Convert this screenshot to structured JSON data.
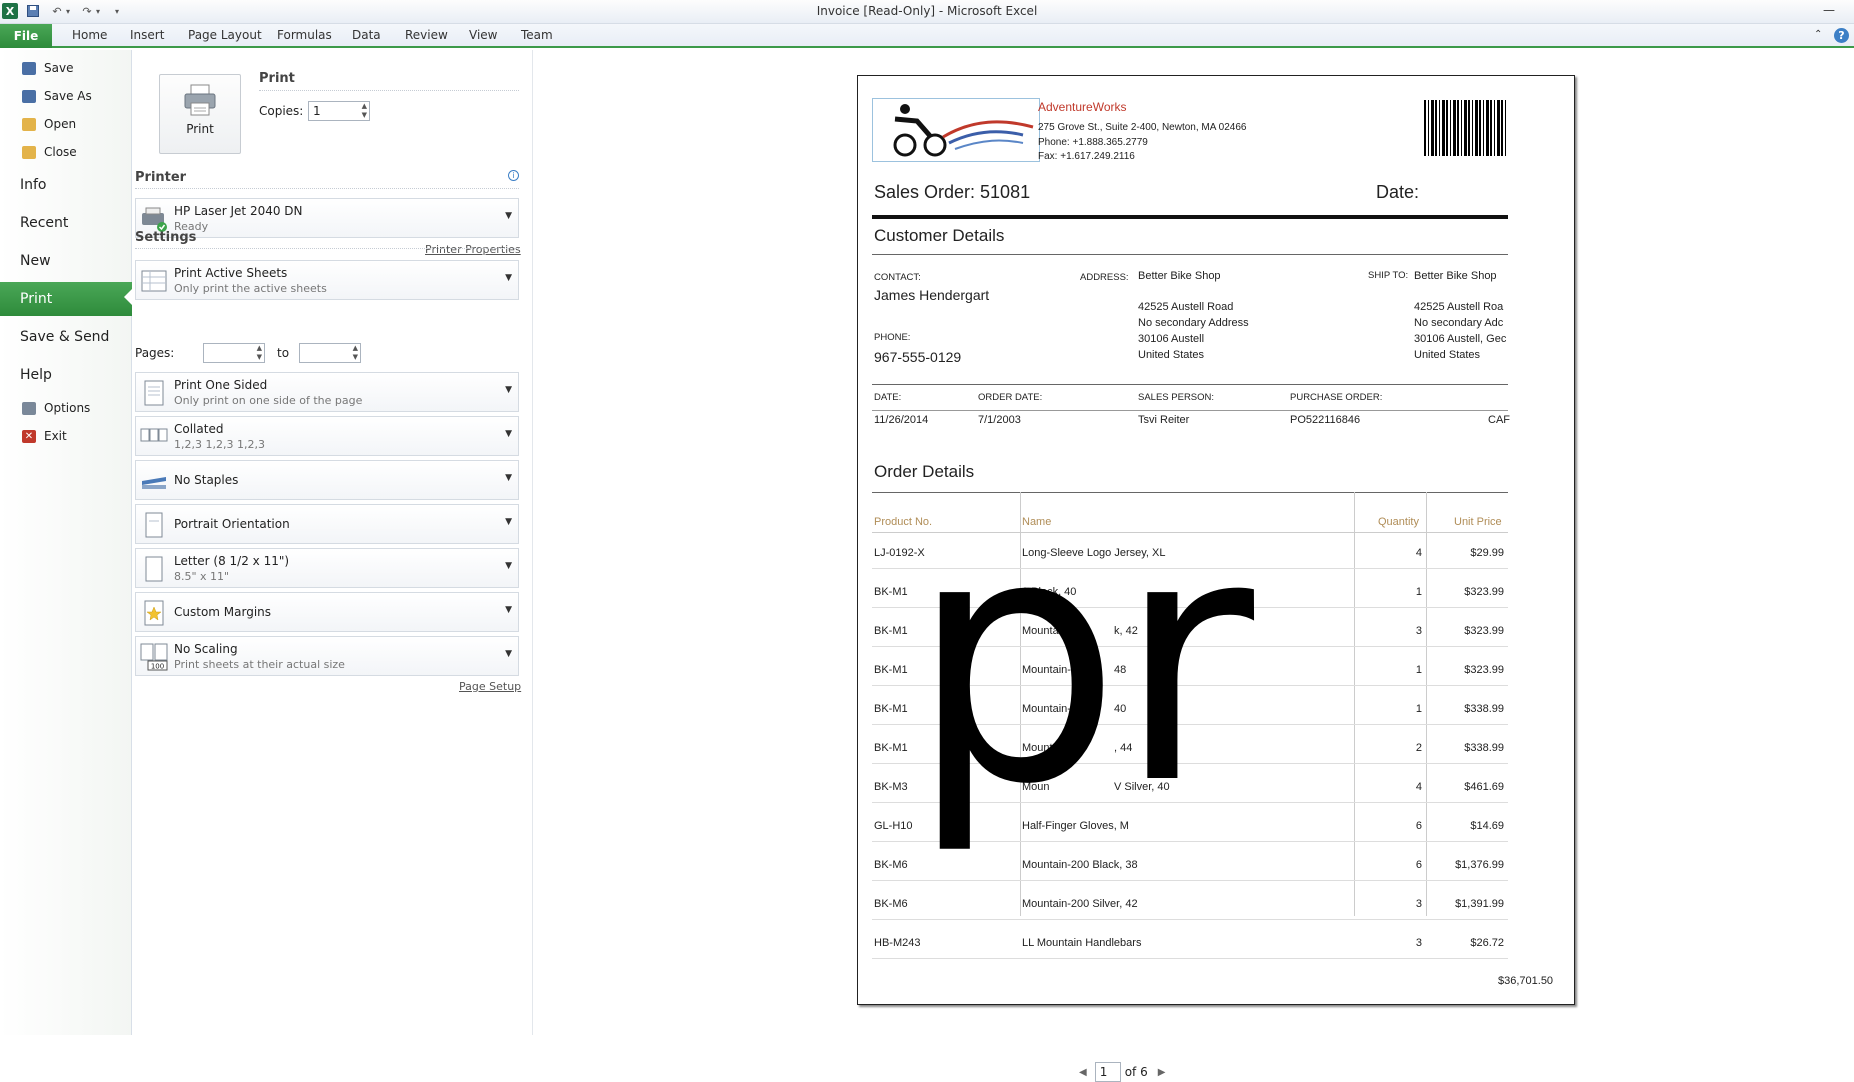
{
  "window": {
    "title": "Invoice  [Read-Only]  -  Microsoft Excel",
    "app_icon": "excel-icon"
  },
  "ribbon": {
    "file": "File",
    "tabs": [
      "Home",
      "Insert",
      "Page Layout",
      "Formulas",
      "Data",
      "Review",
      "View",
      "Team"
    ]
  },
  "nav": {
    "save": "Save",
    "save_as": "Save As",
    "open": "Open",
    "close": "Close",
    "info": "Info",
    "recent": "Recent",
    "new": "New",
    "print": "Print",
    "save_send": "Save & Send",
    "help": "Help",
    "options": "Options",
    "exit": "Exit"
  },
  "print": {
    "heading": "Print",
    "button": "Print",
    "copies_label": "Copies:",
    "copies_value": "1"
  },
  "printer": {
    "heading": "Printer",
    "name": "HP Laser Jet 2040 DN",
    "status": "Ready",
    "properties_link": "Printer Properties"
  },
  "settings": {
    "heading": "Settings",
    "sheets": {
      "title": "Print Active Sheets",
      "sub": "Only print the active sheets"
    },
    "pages_label": "Pages:",
    "to_label": "to",
    "sided": {
      "title": "Print One Sided",
      "sub": "Only print on one side of the page"
    },
    "collated": {
      "title": "Collated",
      "sub": "1,2,3    1,2,3    1,2,3"
    },
    "staples": {
      "title": "No Staples"
    },
    "orientation": {
      "title": "Portrait Orientation"
    },
    "paper": {
      "title": "Letter (8 1/2 x 11\")",
      "sub": "8.5\" x 11\""
    },
    "margins": {
      "title": "Custom Margins"
    },
    "scaling": {
      "title": "No Scaling",
      "sub": "Print sheets at their actual size"
    },
    "scaling_badge": "100",
    "page_setup_link": "Page Setup"
  },
  "invoice": {
    "company": "AdventureWorks",
    "address": "275 Grove St., Suite 2-400, Newton, MA 02466",
    "phone": "Phone: +1.888.365.2779",
    "fax": "Fax: +1.617.249.2116",
    "sales_order": "Sales Order: 51081",
    "date_label": "Date:",
    "customer_details": "Customer Details",
    "contact_label": "CONTACT:",
    "contact_name": "James Hendergart",
    "phone_label": "PHONE:",
    "phone_value": "967-555-0129",
    "address_label": "ADDRESS:",
    "address_lines": [
      "Better Bike Shop",
      "",
      "42525 Austell Road",
      "No secondary Address",
      "30106 Austell",
      "United States"
    ],
    "ship_to_label": "SHIP TO:",
    "ship_lines": [
      "Better Bike Shop",
      "",
      "42525 Austell Roa",
      "No secondary Adc",
      "30106 Austell, Gec",
      "United States"
    ],
    "info_headers": [
      "DATE:",
      "ORDER DATE:",
      "SALES PERSON:",
      "PURCHASE ORDER:"
    ],
    "info_values": [
      "11/26/2014",
      "7/1/2003",
      "Tsvi Reiter",
      "PO522116846",
      "CAF"
    ],
    "order_details": "Order Details",
    "columns": [
      "Product No.",
      "Name",
      "Quantity",
      "Unit Price"
    ],
    "rows": [
      {
        "no": "LJ-0192-X",
        "name": "Long-Sleeve Logo Jersey, XL",
        "qty": "4",
        "price": "$29.99"
      },
      {
        "no": "BK-M1",
        "name": "0 Black, 40",
        "qty": "1",
        "price": "$323.99"
      },
      {
        "no": "BK-M1",
        "name": "Mountain-",
        "name2": "k, 42",
        "qty": "3",
        "price": "$323.99"
      },
      {
        "no": "BK-M1",
        "name": "Mountain-500",
        "name2": "48",
        "qty": "1",
        "price": "$323.99"
      },
      {
        "no": "BK-M1",
        "name": "Mountain-500",
        "name2": "40",
        "qty": "1",
        "price": "$338.99"
      },
      {
        "no": "BK-M1",
        "name": "Mountain-5",
        "name2": ", 44",
        "qty": "2",
        "price": "$338.99"
      },
      {
        "no": "BK-M3",
        "name": "Moun",
        "name2": "V Silver, 40",
        "qty": "4",
        "price": "$461.69"
      },
      {
        "no": "GL-H10",
        "name": "Half-Finger Gloves, M",
        "qty": "6",
        "price": "$14.69"
      },
      {
        "no": "BK-M6",
        "name": "Mountain-200 Black, 38",
        "qty": "6",
        "price": "$1,376.99"
      },
      {
        "no": "BK-M6",
        "name": "Mountain-200 Silver, 42",
        "qty": "3",
        "price": "$1,391.99"
      },
      {
        "no": "HB-M243",
        "name": "LL Mountain Handlebars",
        "qty": "3",
        "price": "$26.72"
      }
    ],
    "total": "$36,701.50"
  },
  "overlay_text": "pr",
  "pager": {
    "current": "1",
    "of": "of 6"
  },
  "colors": {
    "accent": "#2e8b3b",
    "gold": "#b08d57",
    "company": "#c0392b"
  }
}
